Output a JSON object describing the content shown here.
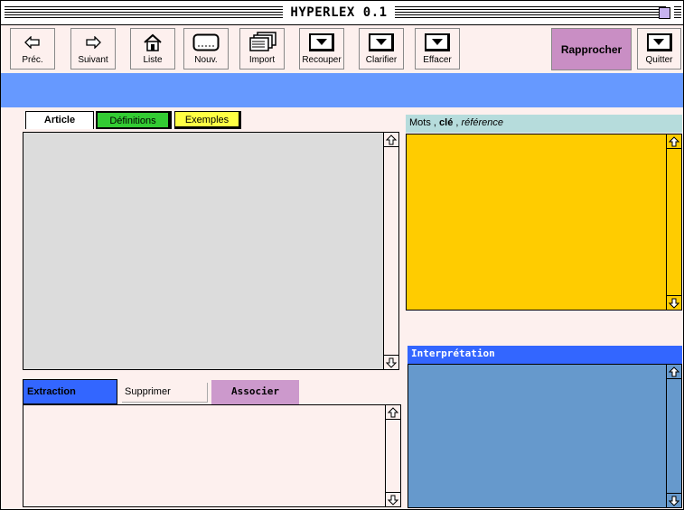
{
  "window": {
    "title": "HYPERLEX 0.1"
  },
  "toolbar": {
    "prev": "Préc.",
    "next": "Suivant",
    "list": "Liste",
    "new": "Nouv.",
    "import": "Import",
    "recouper": "Recouper",
    "clarifier": "Clarifier",
    "effacer": "Effacer",
    "rapprocher": "Rapprocher",
    "quit": "Quitter"
  },
  "tabs": {
    "article": "Article",
    "definitions": "Définitions",
    "exemples": "Exemples"
  },
  "keywords_header": {
    "part1": "Mots",
    "sep1": " , ",
    "part2": "clé",
    "sep2": " , ",
    "part3": "référence"
  },
  "actions": {
    "extraction": "Extraction",
    "supprimer": "Supprimer",
    "associer": "Associer"
  },
  "interpretation": {
    "title": "Interprétation"
  },
  "colors": {
    "background": "#fdf0ee",
    "banner": "#6699ff",
    "keywords_panel": "#ffcc00",
    "interpretation_panel": "#6699cc",
    "rapprocher": "#c98ec4",
    "tab_definitions": "#33cc33",
    "tab_exemples": "#ffff44",
    "extraction": "#3366ff",
    "associer": "#cc99cc"
  }
}
